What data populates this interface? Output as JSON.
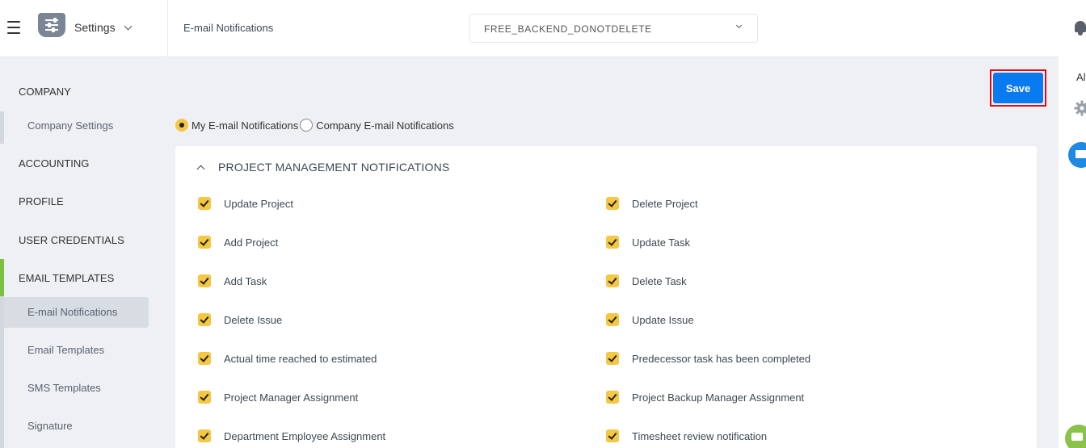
{
  "header": {
    "module_label": "Settings",
    "page_title": "E-mail Notifications",
    "company_selected": "FREE_BACKEND_DONOTDELETE"
  },
  "right_rail": {
    "partial_text": "Al"
  },
  "sidebar": {
    "company": "COMPANY",
    "company_settings": "Company Settings",
    "accounting": "ACCOUNTING",
    "profile": "PROFILE",
    "user_credentials": "USER CREDENTIALS",
    "email_templates": "EMAIL TEMPLATES",
    "email_notifications": "E-mail Notifications",
    "email_templates_sub": "Email Templates",
    "sms_templates": "SMS Templates",
    "signature": "Signature"
  },
  "toolbar": {
    "save_label": "Save"
  },
  "scope": {
    "my": "My E-mail Notifications",
    "company": "Company E-mail Notifications",
    "selected": "my"
  },
  "section": {
    "title": "PROJECT MANAGEMENT NOTIFICATIONS",
    "left": [
      {
        "label": "Update Project",
        "checked": true
      },
      {
        "label": "Add Project",
        "checked": true
      },
      {
        "label": "Add Task",
        "checked": true
      },
      {
        "label": "Delete Issue",
        "checked": true
      },
      {
        "label": "Actual time reached to estimated",
        "checked": true
      },
      {
        "label": "Project Manager Assignment",
        "checked": true
      },
      {
        "label": "Department Employee Assignment",
        "checked": true
      }
    ],
    "right": [
      {
        "label": "Delete Project",
        "checked": true
      },
      {
        "label": "Update Task",
        "checked": true
      },
      {
        "label": "Delete Task",
        "checked": true
      },
      {
        "label": "Update Issue",
        "checked": true
      },
      {
        "label": "Predecessor task has been completed",
        "checked": true
      },
      {
        "label": "Project Backup Manager Assignment",
        "checked": true
      },
      {
        "label": "Timesheet review notification",
        "checked": true
      }
    ]
  },
  "colors": {
    "accent_yellow": "#f6c743",
    "save_blue": "#0a7af0",
    "highlight_red": "#e30613",
    "active_green": "#7cc242"
  }
}
